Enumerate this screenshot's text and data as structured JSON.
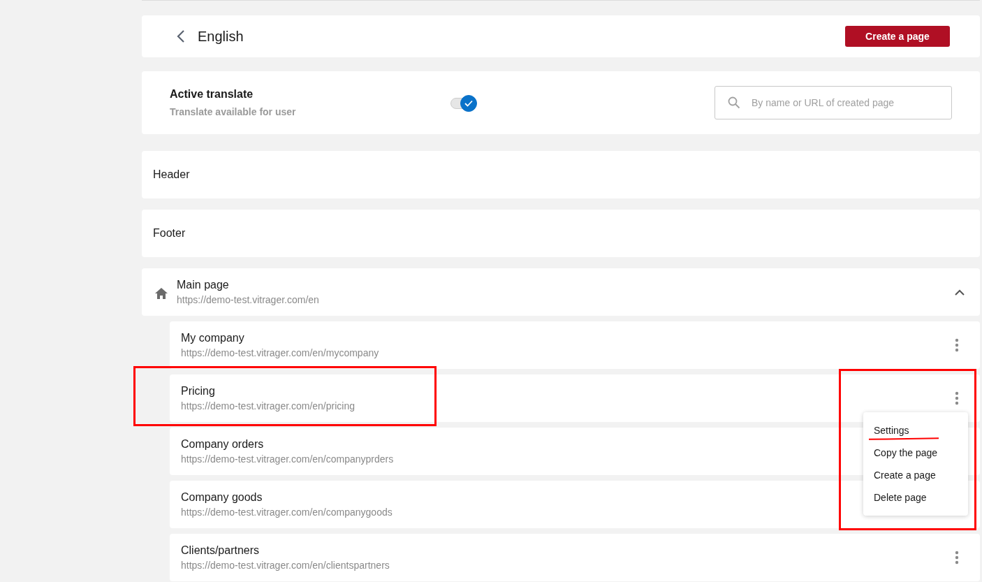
{
  "header": {
    "title": "English",
    "create_button": "Create a page"
  },
  "translate": {
    "title": "Active translate",
    "subtitle": "Translate available for user",
    "on": true
  },
  "search": {
    "placeholder": "By name or URL of created page"
  },
  "sections": [
    {
      "label": "Header"
    },
    {
      "label": "Footer"
    }
  ],
  "main_page": {
    "title": "Main page",
    "url": "https://demo-test.vitrager.com/en",
    "expanded": true,
    "children": [
      {
        "title": "My company",
        "url": "https://demo-test.vitrager.com/en/mycompany",
        "highlighted": false,
        "more_button": true
      },
      {
        "title": "Pricing",
        "url": "https://demo-test.vitrager.com/en/pricing",
        "highlighted": true,
        "more_button": true,
        "menu": {
          "highlighted": true,
          "items": [
            {
              "label": "Settings",
              "underlined": true
            },
            {
              "label": "Copy the page",
              "underlined": false
            },
            {
              "label": "Create a page",
              "underlined": false
            },
            {
              "label": "Delete page",
              "underlined": false
            }
          ]
        }
      },
      {
        "title": "Company orders",
        "url": "https://demo-test.vitrager.com/en/companyprders",
        "highlighted": false,
        "more_button": false
      },
      {
        "title": "Company goods",
        "url": "https://demo-test.vitrager.com/en/companygoods",
        "highlighted": false,
        "more_button": false
      },
      {
        "title": "Clients/partners",
        "url": "https://demo-test.vitrager.com/en/clientspartners",
        "highlighted": false,
        "more_button": true
      }
    ]
  }
}
